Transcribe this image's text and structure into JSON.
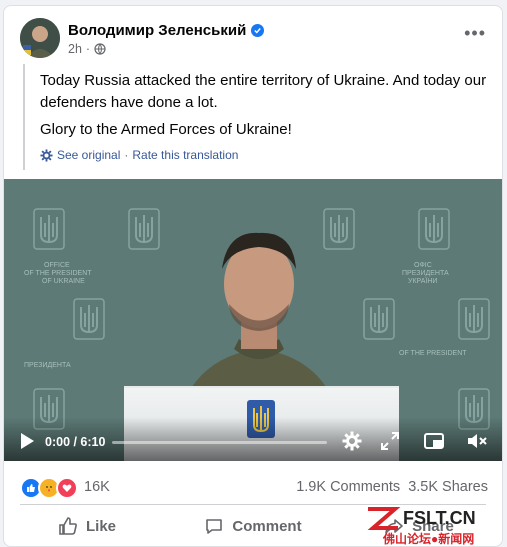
{
  "post": {
    "author": "Володимир Зеленський",
    "time": "2h",
    "paragraph1": "Today Russia attacked the entire territory of Ukraine. And today our defenders have done a lot.",
    "paragraph2": "Glory to the Armed Forces of Ukraine!",
    "see_original": "See original",
    "separator": "·",
    "rate_translation": "Rate this translation"
  },
  "video": {
    "time": "0:00 / 6:10",
    "progress": 0,
    "backdrop_text_en": "OFFICE OF THE PRESIDENT OF UKRAINE",
    "backdrop_text_ua": "ОФІС ПРЕЗИДЕНТА УКРАЇНИ"
  },
  "stats": {
    "reactions_count": "16K",
    "comments": "1.9K Comments",
    "shares": "3.5K Shares"
  },
  "actions": {
    "like": "Like",
    "comment": "Comment",
    "share": "Share"
  },
  "watermark": {
    "logo": "FSLT.CN",
    "caption": "佛山论坛●新闻网"
  },
  "colors": {
    "link": "#385898",
    "verified": "#1877f2",
    "muted": "#65676b",
    "backdrop": "#5d7a76"
  }
}
